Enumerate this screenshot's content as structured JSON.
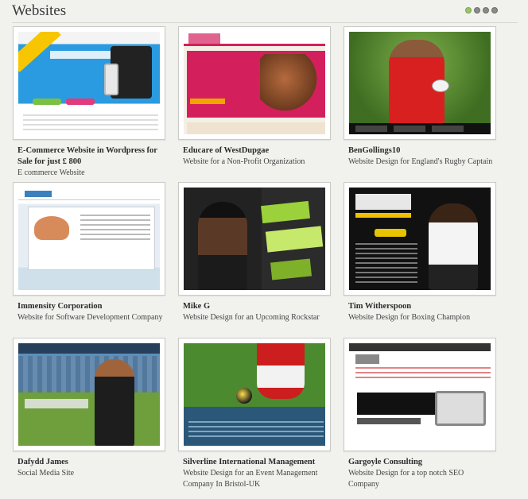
{
  "section": {
    "title": "Websites",
    "pager_dots": 4,
    "active_dot": 1
  },
  "projects": [
    {
      "title": "E-Commerce Website in Wordpress for Sale for just £ 800",
      "description": "E commerce Website"
    },
    {
      "title": "Educare of WestDupgae",
      "description": "Website for a Non-Profit Organization"
    },
    {
      "title": "BenGollings10",
      "description": "Website Design for England's Rugby Captain"
    },
    {
      "title": "Immensity Corporation",
      "description": "Website for Software Development Company"
    },
    {
      "title": "Mike G",
      "description": "Website Design for an Upcoming Rockstar"
    },
    {
      "title": "Tim Witherspoon",
      "description": "Website Design for Boxing Champion"
    },
    {
      "title": "Dafydd James",
      "description": "Social Media Site"
    },
    {
      "title": "Silverline International Management",
      "description": "Website Design for an Event Management Company In Bristol-UK"
    },
    {
      "title": "Gargoyle Consulting",
      "description": "Website Design for a top notch SEO Company"
    }
  ],
  "colors": {
    "background": "#f1f1ee",
    "pager_active": "#9cc36a",
    "pager_inactive": "#8a8a8a"
  }
}
